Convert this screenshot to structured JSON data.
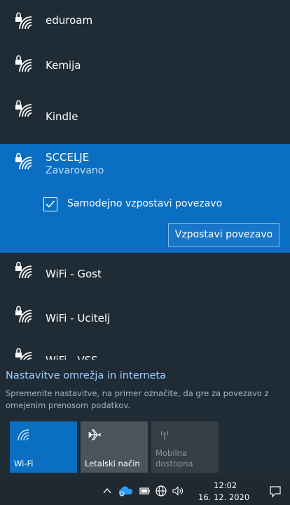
{
  "networks_before": [
    {
      "name": "eduroam"
    },
    {
      "name": "Kemija"
    },
    {
      "name": "Kindle"
    }
  ],
  "selected_network": {
    "name": "SCCELJE",
    "status": "Zavarovano",
    "auto_connect_label": "Samodejno vzpostavi povezavo",
    "auto_connect_checked": true,
    "connect_button_label": "Vzpostavi povezavo"
  },
  "networks_after": [
    {
      "name": "WiFi - Gost"
    },
    {
      "name": "WiFi - Ucitelj"
    },
    {
      "name": "WiFi - VSS"
    }
  ],
  "settings": {
    "link": "Nastavitve omrežja in interneta",
    "description": "Spremenite nastavitve, na primer označite, da gre za povezavo z omejenim prenosom podatkov."
  },
  "quick_actions": {
    "wifi": {
      "label": "Wi-Fi",
      "icon": "wifi-icon",
      "active": true
    },
    "airplane": {
      "label": "Letalski način",
      "icon": "airplane-icon",
      "active": false
    },
    "mobile": {
      "label_line1": "Mobilna",
      "label_line2": "dostopna",
      "icon": "hotspot-icon",
      "active": false
    }
  },
  "taskbar": {
    "time": "12:02",
    "date": "16. 12. 2020"
  },
  "colors": {
    "accent": "#0a6fc2",
    "background": "#1f2b35",
    "link": "#9fd0ff"
  }
}
